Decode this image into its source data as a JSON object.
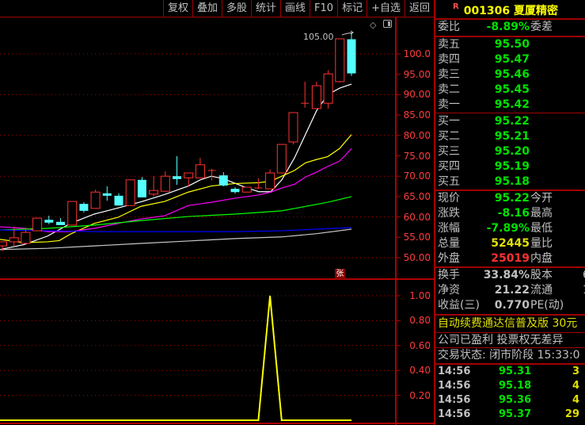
{
  "toolbar": [
    "复权",
    "叠加",
    "多股",
    "统计",
    "画线",
    "F10",
    "标记",
    "+自选",
    "返回"
  ],
  "chart": {
    "high_label": "105.00",
    "price_axis": [
      "100.0",
      "95.00",
      "90.00",
      "85.00",
      "80.00",
      "75.00",
      "70.00",
      "65.00",
      "60.00",
      "55.00",
      "50.00"
    ],
    "price_axis_values": [
      100,
      95,
      90,
      85,
      80,
      75,
      70,
      65,
      60,
      55,
      50
    ],
    "indicator_axis": [
      "1.00",
      "0.80",
      "0.60",
      "0.40",
      "0.20"
    ],
    "indicator_axis_values": [
      1,
      0.8,
      0.6,
      0.4,
      0.2
    ],
    "zhang_badge": "张",
    "candles": [
      [
        52.9,
        53.9,
        51.6,
        53.9
      ],
      [
        53.9,
        57.6,
        52.9,
        54.9
      ],
      [
        53.5,
        57.4,
        53.5,
        56.2
      ],
      [
        56.6,
        59.7,
        56.6,
        59.7
      ],
      [
        59.3,
        60.3,
        58.2,
        58.6
      ],
      [
        58.8,
        59.7,
        58.0,
        58.0
      ],
      [
        58.0,
        63.8,
        58.0,
        63.8
      ],
      [
        63.2,
        63.6,
        61.1,
        61.5
      ],
      [
        62.1,
        66.7,
        62.1,
        66.1
      ],
      [
        65.8,
        67.5,
        64.0,
        65.2
      ],
      [
        65.2,
        65.8,
        62.8,
        62.8
      ],
      [
        62.8,
        69.1,
        62.8,
        69.1
      ],
      [
        69.1,
        69.8,
        64.8,
        64.8
      ],
      [
        65.6,
        70.0,
        65.0,
        66.5
      ],
      [
        66.3,
        71.2,
        66.3,
        70.0
      ],
      [
        70.0,
        74.9,
        67.9,
        69.3
      ],
      [
        69.6,
        70.8,
        67.5,
        70.8
      ],
      [
        69.6,
        74.5,
        69.6,
        72.8
      ],
      [
        71.4,
        71.8,
        69.0,
        71.4
      ],
      [
        70.2,
        71.0,
        67.5,
        67.7
      ],
      [
        66.9,
        67.3,
        65.7,
        66.1
      ],
      [
        66.1,
        67.3,
        66.1,
        67.3
      ],
      [
        67.1,
        69.5,
        66.9,
        67.1
      ],
      [
        66.9,
        71.6,
        66.9,
        70.8
      ],
      [
        70.8,
        77.8,
        70.8,
        77.8
      ],
      [
        78.4,
        85.6,
        77.8,
        85.6
      ],
      [
        87.9,
        93.2,
        86.8,
        87.9
      ],
      [
        86.6,
        93.2,
        86.6,
        92.2
      ],
      [
        87.9,
        96.0,
        86.6,
        95.1
      ],
      [
        93.2,
        103.7,
        93.0,
        103.7
      ],
      [
        103.6,
        105.0,
        94.6,
        95.22
      ]
    ],
    "ma": [
      {
        "color": "#ffffff",
        "values": [
          52.0,
          53.2,
          55.3,
          58.4,
          60.7,
          62.2,
          63.7,
          65.5,
          67.6,
          69.1,
          70.0,
          69.4,
          67.1,
          66.2,
          66.2,
          69.1,
          74.5,
          80.3,
          86.1,
          90.0,
          91.6,
          92.6
        ]
      },
      {
        "color": "#ffff00",
        "values": [
          54.5,
          53.7,
          53.9,
          54.2,
          55.8,
          58.4,
          59.9,
          62.6,
          63.8,
          66.1,
          67.6,
          68.2,
          68.4,
          68.8,
          70.0,
          71.4,
          73.3,
          74.1,
          74.8,
          76.8,
          80.2,
          83.5
        ]
      },
      {
        "color": "#ff00ff",
        "values": [
          57.6,
          57.2,
          56.4,
          56.4,
          57.2,
          58.4,
          59.5,
          60.3,
          62.8,
          63.6,
          64.6,
          65.4,
          66.1,
          67.1,
          68.0,
          69.8,
          71.0,
          72.4,
          73.7,
          75.1,
          76.8
        ]
      },
      {
        "color": "#00ff00",
        "values": [
          56.8,
          57.2,
          58.0,
          59.1,
          60.1,
          60.7,
          61.5,
          63.6,
          65.0
        ]
      },
      {
        "color": "#0000ff",
        "values": [
          56.8,
          56.6,
          56.4,
          56.4,
          56.4,
          56.4,
          56.6,
          57.0,
          57.4
        ]
      },
      {
        "color": "#c8c8c8",
        "values": [
          52.0,
          52.3,
          52.9,
          53.5,
          54.1,
          54.7,
          55.1,
          55.9,
          57.0
        ]
      }
    ],
    "ma_x": [
      [
        0,
        30,
        60,
        89,
        119,
        149,
        178,
        208,
        238,
        253,
        267,
        282,
        312,
        327,
        342,
        356,
        372,
        386,
        400,
        414,
        429,
        444
      ],
      [
        0,
        30,
        60,
        75,
        89,
        119,
        149,
        178,
        208,
        238,
        267,
        297,
        327,
        342,
        356,
        372,
        386,
        400,
        414,
        429,
        444
      ],
      [
        0,
        30,
        60,
        89,
        119,
        149,
        178,
        208,
        238,
        267,
        297,
        327,
        342,
        356,
        372,
        386,
        400,
        414,
        429,
        436,
        444
      ],
      [
        0,
        60,
        119,
        178,
        238,
        297,
        356,
        414,
        444
      ],
      [
        0,
        60,
        119,
        178,
        238,
        297,
        356,
        400,
        444
      ],
      [
        0,
        60,
        119,
        178,
        238,
        297,
        356,
        400,
        444
      ]
    ],
    "indicator": [
      0,
      0,
      0,
      0,
      0,
      0,
      0,
      0,
      0,
      0,
      0,
      0,
      0,
      0,
      0,
      0,
      0,
      0,
      0,
      0,
      0,
      0,
      0,
      1,
      0,
      0,
      0,
      0,
      0,
      0,
      0
    ],
    "colors": {
      "up": "#ff3232",
      "down": "#54ffff",
      "grid": "#b00000",
      "indicator": "#ffff00"
    }
  },
  "quote": {
    "badge": "R",
    "code": "001306",
    "name": "夏厦精密",
    "weibi": {
      "label": "委比",
      "value": "-8.89%",
      "label2": "委差"
    },
    "sell": [
      {
        "label": "卖五",
        "price": "95.50"
      },
      {
        "label": "卖四",
        "price": "95.47"
      },
      {
        "label": "卖三",
        "price": "95.46"
      },
      {
        "label": "卖二",
        "price": "95.45"
      },
      {
        "label": "卖一",
        "price": "95.42"
      }
    ],
    "buy": [
      {
        "label": "买一",
        "price": "95.22"
      },
      {
        "label": "买二",
        "price": "95.21"
      },
      {
        "label": "买三",
        "price": "95.20"
      },
      {
        "label": "买四",
        "price": "95.19"
      },
      {
        "label": "买五",
        "price": "95.18"
      }
    ],
    "stats": [
      {
        "label": "现价",
        "value": "95.22",
        "label2": "今开",
        "cls": "g"
      },
      {
        "label": "涨跌",
        "value": "-8.16",
        "label2": "最高",
        "cls": "g"
      },
      {
        "label": "涨幅",
        "value": "-7.89%",
        "label2": "最低",
        "cls": "g"
      },
      {
        "label": "总量",
        "value": "52445",
        "label2": "量比",
        "cls": "y"
      },
      {
        "label": "外盘",
        "value": "25019",
        "label2": "内盘",
        "cls": "rd"
      }
    ],
    "fund": [
      {
        "label": "换手",
        "value": "33.84%",
        "label2": "股本",
        "value2": "6"
      },
      {
        "label": "净资",
        "value": "21.22",
        "label2": "流通",
        "value2": "1"
      },
      {
        "label": "收益(三)",
        "value": "0.770",
        "label2": "PE(动)",
        "value2": ""
      }
    ],
    "promo": "自动续费通达信普及版  30元",
    "notice": "公司已盈利 投票权无差异",
    "status": "交易状态: 闭市阶段 15:33:0",
    "trades": [
      {
        "time": "14:56",
        "price": "95.31",
        "vol": "3"
      },
      {
        "time": "14:56",
        "price": "95.18",
        "vol": "4"
      },
      {
        "time": "14:56",
        "price": "95.36",
        "vol": "4"
      },
      {
        "time": "14:56",
        "price": "95.37",
        "vol": "29"
      }
    ]
  }
}
